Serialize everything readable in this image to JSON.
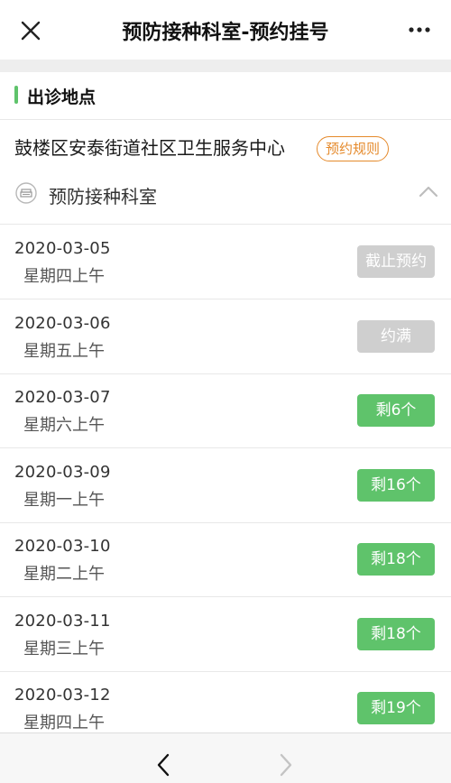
{
  "header": {
    "title": "预防接种科室-预约挂号",
    "close_icon": "close-icon",
    "more_icon": "more-icon"
  },
  "section": {
    "title": "出诊地点"
  },
  "location": {
    "name": "鼓楼区安泰街道社区卫生服务中心",
    "rules_label": "预约规则"
  },
  "department": {
    "name": "预防接种科室",
    "icon": "department-icon",
    "expand_icon": "chevron-up-icon"
  },
  "schedule": [
    {
      "date": "2020-03-05",
      "weekday": "星期四上午",
      "status": "截止预约",
      "available": false
    },
    {
      "date": "2020-03-06",
      "weekday": "星期五上午",
      "status": "约满",
      "available": false
    },
    {
      "date": "2020-03-07",
      "weekday": "星期六上午",
      "status": "剩6个",
      "available": true
    },
    {
      "date": "2020-03-09",
      "weekday": "星期一上午",
      "status": "剩16个",
      "available": true
    },
    {
      "date": "2020-03-10",
      "weekday": "星期二上午",
      "status": "剩18个",
      "available": true
    },
    {
      "date": "2020-03-11",
      "weekday": "星期三上午",
      "status": "剩18个",
      "available": true
    },
    {
      "date": "2020-03-12",
      "weekday": "星期四上午",
      "status": "剩19个",
      "available": true
    }
  ],
  "nav": {
    "back_icon": "back-arrow-icon",
    "forward_icon": "forward-arrow-icon"
  },
  "colors": {
    "accent_green": "#5fc36b",
    "rule_orange": "#e58a2c",
    "disabled_gray": "#cfcfcf"
  }
}
